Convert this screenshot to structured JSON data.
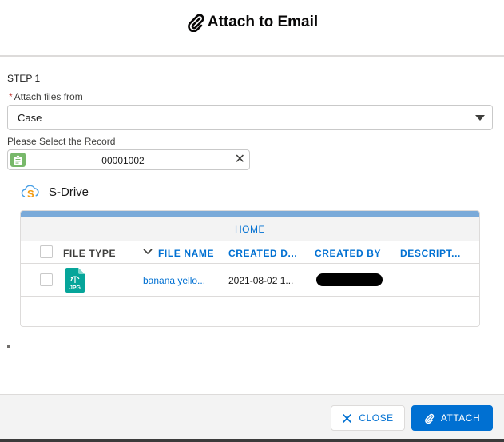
{
  "header": {
    "title": "Attach to Email",
    "icon": "paperclip-icon"
  },
  "form": {
    "step_label": "STEP 1",
    "attach_from_required_mark": "*",
    "attach_from_label": "Attach files from",
    "attach_from_value": "Case",
    "record_label": "Please Select the Record",
    "record_value": "00001002",
    "record_icon": "record-icon",
    "clear_glyph": "✕"
  },
  "sdrive": {
    "label": "S-Drive",
    "icon": "s-drive-cloud-icon"
  },
  "table": {
    "breadcrumb": "HOME",
    "columns": [
      "FILE TYPE",
      "FILE NAME",
      "CREATED D...",
      "CREATED BY",
      "DESCRIPT..."
    ],
    "sort_column": "FILE NAME",
    "rows": [
      {
        "file_type": "JPG",
        "file_name": "banana yello...",
        "created_date": "2021-08-02 1...",
        "created_by": "",
        "description": ""
      }
    ]
  },
  "footer": {
    "close_label": "CLOSE",
    "attach_label": "ATTACH"
  },
  "colors": {
    "brand": "#0070d2",
    "bar": "#7aaad9",
    "jpg_icon": "#06a59a"
  }
}
